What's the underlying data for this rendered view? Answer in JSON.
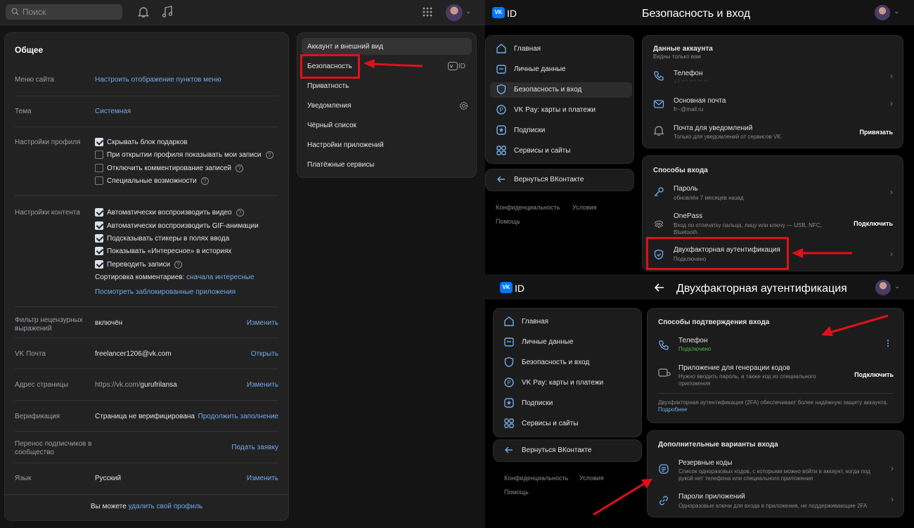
{
  "left": {
    "search_placeholder": "Поиск",
    "settings": {
      "title": "Общее",
      "rows": {
        "menu": {
          "label": "Меню сайта",
          "value": "Настроить отображение пунктов меню"
        },
        "theme": {
          "label": "Тема",
          "value": "Системная"
        },
        "profile": {
          "label": "Настройки профиля",
          "options": [
            {
              "text": "Скрывать блок подарков",
              "checked": true
            },
            {
              "text": "При открытии профиля показывать мои записи",
              "checked": false
            },
            {
              "text": "Отключить комментирование записей",
              "checked": false
            },
            {
              "text": "Специальные возможности",
              "checked": false
            }
          ]
        },
        "content": {
          "label": "Настройки контента",
          "options": [
            {
              "text": "Автоматически воспроизводить видео",
              "checked": true
            },
            {
              "text": "Автоматически воспроизводить GIF-анимации",
              "checked": true
            },
            {
              "text": "Подсказывать стикеры в полях ввода",
              "checked": true
            },
            {
              "text": "Показывать «Интересное» в историях",
              "checked": true
            },
            {
              "text": "Переводить записи",
              "checked": true
            }
          ],
          "sort_prefix": "Сортировка комментариев:",
          "sort_value": "сначала интересные",
          "blocked_apps": "Посмотреть заблокированные приложения"
        },
        "filter": {
          "label": "Фильтр нецензурных выражений",
          "value": "включён",
          "action": "Изменить"
        },
        "mail": {
          "label": "VK Почта",
          "value": "freelancer1206@vk.com",
          "action": "Открыть"
        },
        "address": {
          "label": "Адрес страницы",
          "prefix": "https://vk.com/",
          "value": "gurufrilansa",
          "action": "Изменить"
        },
        "verification": {
          "label": "Верификация",
          "value": "Страница не верифицирована",
          "action": "Продолжить заполнение"
        },
        "transfer": {
          "label": "Перенос подписчиков в сообщество",
          "action": "Подать заявку"
        },
        "language": {
          "label": "Язык",
          "value": "Русский",
          "action": "Изменить"
        }
      },
      "footer_prefix": "Вы можете",
      "footer_link": "удалить свой профиль"
    },
    "menu": {
      "items": [
        "Аккаунт и внешний вид",
        "Безопасность",
        "Приватность",
        "Уведомления",
        "Чёрный список",
        "Настройки приложений",
        "Платёжные сервисы"
      ],
      "id_badge": "ID"
    }
  },
  "vkid_top": {
    "logo": "VK",
    "id": "ID",
    "title": "Безопасность и вход",
    "nav": [
      "Главная",
      "Личные данные",
      "Безопасность и вход",
      "VK Pay: карты и платежи",
      "Подписки",
      "Сервисы и сайты"
    ],
    "back": "Вернуться ВКонтакте",
    "footer": [
      "Конфиденциальность",
      "Условия",
      "Помощь"
    ],
    "account": {
      "title": "Данные аккаунта",
      "subtitle": "Видны только вам",
      "phone": {
        "label": "Телефон",
        "value": "+7 *** *** ** **"
      },
      "email": {
        "label": "Основная почта",
        "value": "fr--@mail.ru"
      },
      "notify": {
        "label": "Почта для уведомлений",
        "value": "Только для уведомлений от сервисов VK",
        "action": "Привязать"
      }
    },
    "login": {
      "title": "Способы входа",
      "password": {
        "label": "Пароль",
        "value": "обновлён 7 месяцев назад"
      },
      "onepass": {
        "label": "OnePass",
        "value": "Вход по отпечатку пальца, лицу или ключу — USB, NFC, Bluetooth",
        "action": "Подключить"
      },
      "twofa": {
        "label": "Двухфакторная аутентификация",
        "value": "Подключено"
      }
    }
  },
  "vkid_bottom": {
    "logo": "VK",
    "id": "ID",
    "title": "Двухфакторная аутентификация",
    "nav": [
      "Главная",
      "Личные данные",
      "Безопасность и вход",
      "VK Pay: карты и платежи",
      "Подписки",
      "Сервисы и сайты"
    ],
    "back": "Вернуться ВКонтакте",
    "footer": [
      "Конфиденциальность",
      "Условия",
      "Помощь"
    ],
    "confirm": {
      "title": "Способы подтверждения входа",
      "phone": {
        "label": "Телефон",
        "value": "Подключено"
      },
      "app": {
        "label": "Приложение для генерации кодов",
        "value": "Нужно вводить пароль, а также код из специального приложения",
        "action": "Подключить"
      },
      "note": "Двухфакторная аутентификация (2FA) обеспечивает более надёжную защиту аккаунта.",
      "note_link": "Подробнее"
    },
    "extra": {
      "title": "Дополнительные варианты входа",
      "backup": {
        "label": "Резервные коды",
        "value": "Список одноразовых кодов, с которыми можно войти в аккаунт, когда под рукой нет телефона или специального приложения"
      },
      "apppass": {
        "label": "Пароли приложений",
        "value": "Одноразовые ключи для входа в приложения, не поддерживающие 2FA"
      }
    }
  },
  "colors": {
    "accent": "#71aaeb",
    "highlight": "#e0101a",
    "vk_blue": "#0077ff"
  }
}
